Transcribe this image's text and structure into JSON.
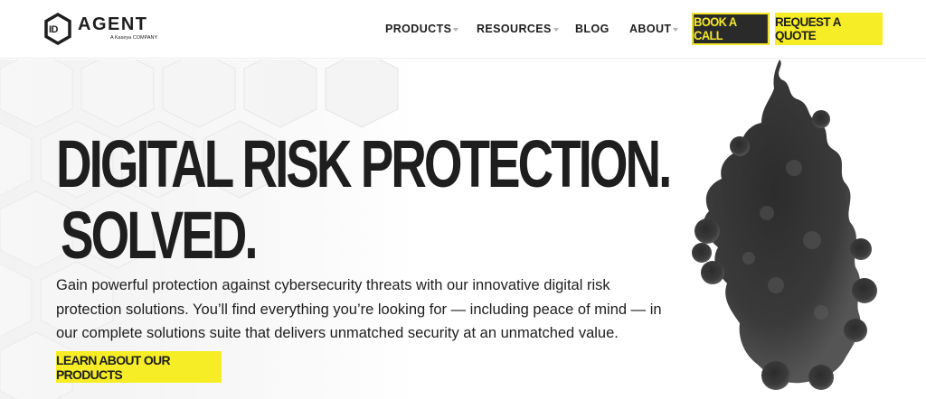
{
  "brand": {
    "logo_mark": "ID",
    "name": "AGENT",
    "tagline": "A Kaseya COMPANY"
  },
  "nav": {
    "items": [
      {
        "label": "PRODUCTS",
        "has_dropdown": true
      },
      {
        "label": "RESOURCES",
        "has_dropdown": true
      },
      {
        "label": "BLOG",
        "has_dropdown": false
      },
      {
        "label": "ABOUT",
        "has_dropdown": true
      }
    ],
    "book_call_label": "BOOK A CALL",
    "request_quote_label": "REQUEST A QUOTE"
  },
  "hero": {
    "title_line1": "DIGITAL RISK PROTECTION.",
    "title_line2": "SOLVED.",
    "description": "Gain powerful protection against cybersecurity threats with our innovative digital risk protection solutions. You’ll find everything you’re looking for — including peace of mind — in our complete solutions suite that delivers  unmatched security at an unmatched value.",
    "cta_label": "LEARN ABOUT OUR PRODUCTS"
  },
  "colors": {
    "accent_yellow": "#f7ed26",
    "dark": "#2a2a2a",
    "text": "#1e1e1e"
  },
  "icons": [
    "hexagon-logo-icon",
    "caret-down-icon",
    "hexagon-pattern-background",
    "smoke-image"
  ]
}
